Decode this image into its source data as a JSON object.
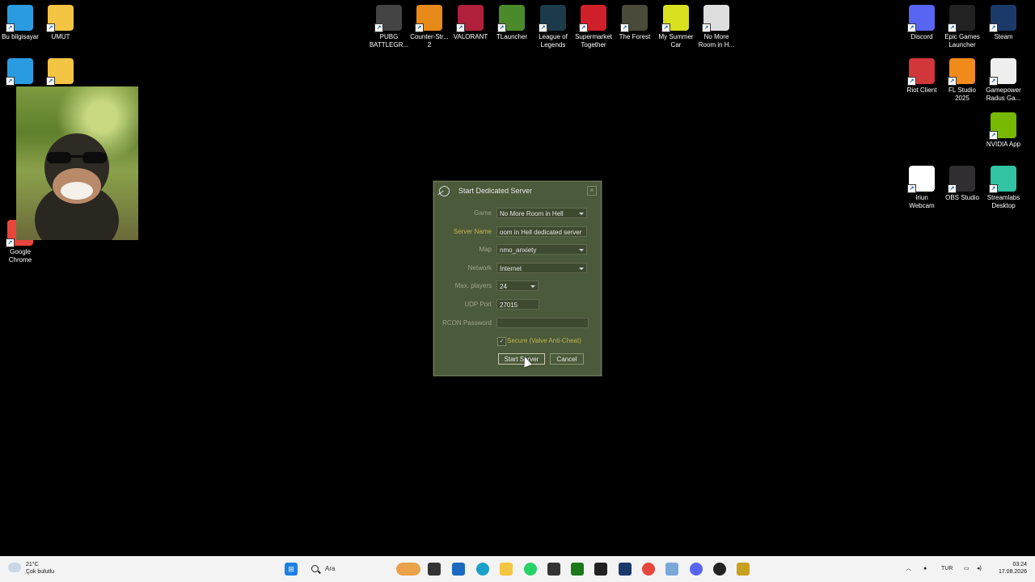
{
  "desktop": {
    "left_icons": [
      {
        "label": "Bu bilgisayar",
        "icon": "this-pc-icon",
        "color": "#2a9be0"
      },
      {
        "label": "UMUT",
        "icon": "folder-icon",
        "color": "#f4c542"
      },
      {
        "label": "",
        "icon": "network-icon",
        "color": "#2a9be0"
      },
      {
        "label": "",
        "icon": "folder-icon",
        "color": "#f4c542"
      },
      {
        "label": "Google\nChrome",
        "icon": "chrome-icon",
        "color": "#e8453c"
      }
    ],
    "top_icons": [
      {
        "label": "PUBG\nBATTLEGR...",
        "icon": "pubg-icon",
        "color": "#444444"
      },
      {
        "label": "Counter-Str...\n2",
        "icon": "cs2-icon",
        "color": "#e88a1a"
      },
      {
        "label": "VALORANT",
        "icon": "valorant-icon",
        "color": "#b0203a"
      },
      {
        "label": "TLauncher",
        "icon": "tlauncher-icon",
        "color": "#4a8a2a"
      },
      {
        "label": "League of\nLegends",
        "icon": "lol-icon",
        "color": "#1b3b4a"
      },
      {
        "label": "Supermarket\nTogether",
        "icon": "supermarket-icon",
        "color": "#d0202a"
      },
      {
        "label": "The Forest",
        "icon": "the-forest-icon",
        "color": "#4a4a3a"
      },
      {
        "label": "My Summer\nCar",
        "icon": "my-summer-car-icon",
        "color": "#d8e020"
      },
      {
        "label": "No More\nRoom in H...",
        "icon": "nmrih-icon",
        "color": "#dddddd"
      }
    ],
    "right_icons": [
      {
        "label": "Discord",
        "icon": "discord-icon",
        "color": "#5865f2"
      },
      {
        "label": "Epic Games\nLauncher",
        "icon": "epic-icon",
        "color": "#222222"
      },
      {
        "label": "Steam",
        "icon": "steam-icon",
        "color": "#1b3a6a"
      },
      {
        "label": "Riot Client",
        "icon": "riot-icon",
        "color": "#d13639"
      },
      {
        "label": "FL Studio\n2025",
        "icon": "fl-studio-icon",
        "color": "#f08a1a"
      },
      {
        "label": "Gamepower\nRadus Ga...",
        "icon": "gamepower-icon",
        "color": "#eeeeee"
      },
      {
        "label": "NVIDIA App",
        "icon": "nvidia-icon",
        "color": "#76b900"
      },
      {
        "label": "Iriun\nWebcam",
        "icon": "iriun-icon",
        "color": "#ffffff"
      },
      {
        "label": "OBS Studio",
        "icon": "obs-icon",
        "color": "#302e31"
      },
      {
        "label": "Streamlabs\nDesktop",
        "icon": "streamlabs-icon",
        "color": "#31c3a2"
      }
    ]
  },
  "dialog": {
    "title": "Start Dedicated Server",
    "close": "×",
    "fields": [
      {
        "label": "Game",
        "value": "No More Room in Hell",
        "dropdown": true
      },
      {
        "label": "Server Name",
        "value": "oom in Hell dedicated server",
        "dropdown": false
      },
      {
        "label": "Map",
        "value": "nmo_anxiety",
        "dropdown": true
      },
      {
        "label": "Network",
        "value": "Internet",
        "dropdown": true
      },
      {
        "label": "Max. players",
        "value": "24",
        "dropdown": true
      },
      {
        "label": "UDP Port",
        "value": "27015",
        "dropdown": false
      },
      {
        "label": "RCON Password",
        "value": "",
        "dropdown": false
      }
    ],
    "secure_label": "Secure (Valve Anti-Cheat)",
    "secure_checked": "✓",
    "start_button": "Start Server",
    "cancel_button": "Cancel"
  },
  "taskbar": {
    "weather_temp": "21°C",
    "weather_desc": "Çok bulutlu",
    "search_placeholder": "Ara",
    "lang": "TUR",
    "time": "03:24",
    "date": "17.08.2026"
  }
}
